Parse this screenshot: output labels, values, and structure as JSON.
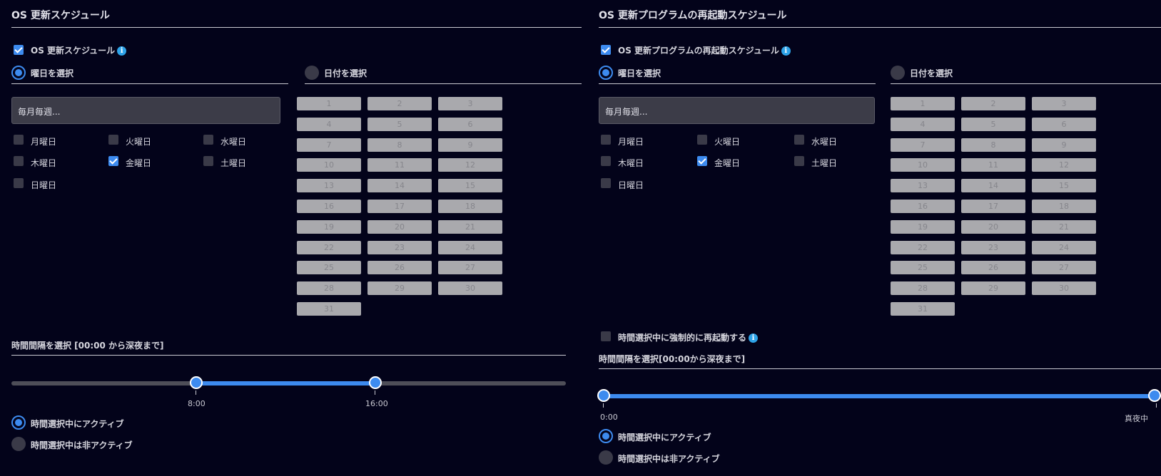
{
  "left": {
    "title": "OS 更新スケジュール",
    "enable_label": "OS 更新スケジュール",
    "weekday_radio": "曜日を選択",
    "date_radio": "日付を選択",
    "select_value": "毎月毎週...",
    "days": [
      "月曜日",
      "火曜日",
      "水曜日",
      "木曜日",
      "金曜日",
      "土曜日",
      "日曜日"
    ],
    "time_heading": "時間間隔を選択 [00:00 から深夜まで]",
    "slider": {
      "start": "8:00",
      "end": "16:00"
    },
    "active_option": "時間選択中にアクティブ",
    "inactive_option": "時間選択中は非アクティブ"
  },
  "right": {
    "title": "OS 更新プログラムの再起動スケジュール",
    "enable_label": "OS 更新プログラムの再起動スケジュール",
    "weekday_radio": "曜日を選択",
    "date_radio": "日付を選択",
    "select_value": "毎月毎週...",
    "days": [
      "月曜日",
      "火曜日",
      "水曜日",
      "木曜日",
      "金曜日",
      "土曜日",
      "日曜日"
    ],
    "force_restart_label": "時間選択中に強制的に再起動する",
    "time_heading": "時間間隔を選択[00:00から深夜まで]",
    "slider": {
      "start": "0:00",
      "end": "真夜中"
    },
    "active_option": "時間選択中にアクティブ",
    "inactive_option": "時間選択中は非アクティブ"
  },
  "dates": [
    "1",
    "2",
    "3",
    "4",
    "5",
    "6",
    "7",
    "8",
    "9",
    "10",
    "11",
    "12",
    "13",
    "14",
    "15",
    "16",
    "17",
    "18",
    "19",
    "20",
    "21",
    "22",
    "23",
    "24",
    "25",
    "26",
    "27",
    "28",
    "29",
    "30",
    "31"
  ],
  "info_icon": "i",
  "colors": {
    "accent": "#3d8bef",
    "background": "#03031a",
    "info": "#2ea3e8"
  }
}
